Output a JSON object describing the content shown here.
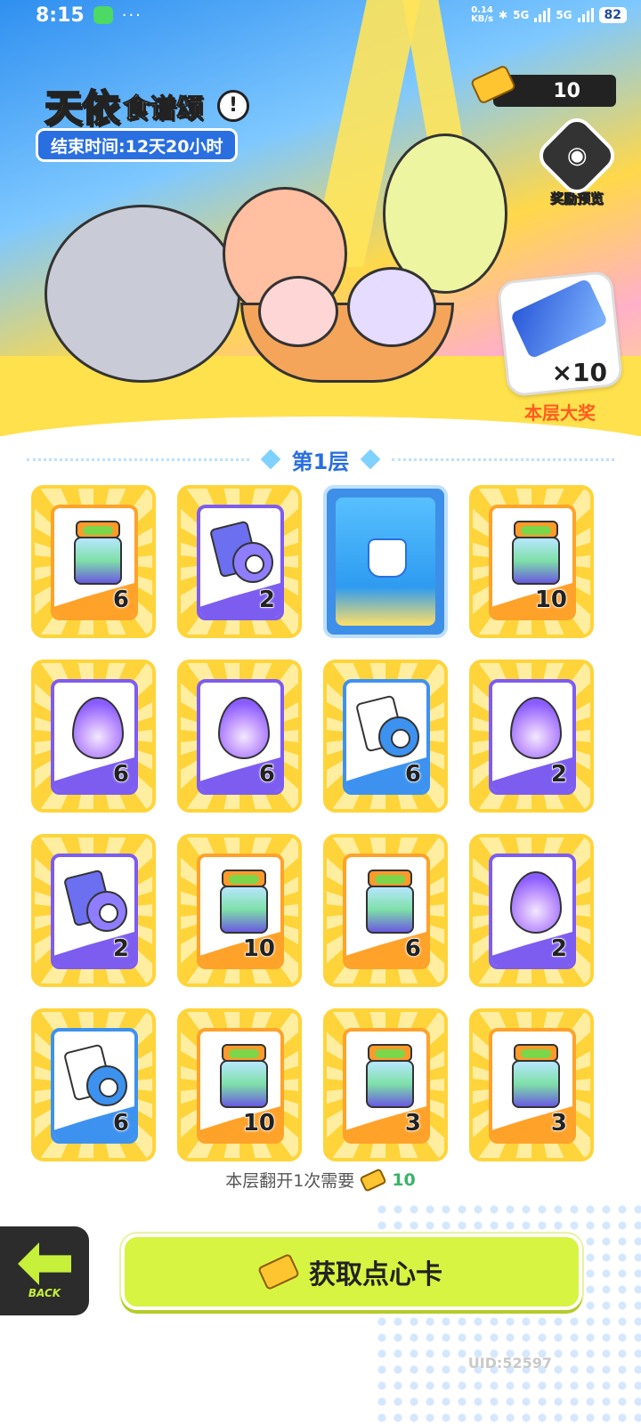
{
  "status_bar": {
    "time": "8:15",
    "net_speed_top": "0.14",
    "net_speed_bottom": "KB/s",
    "sim1": "5G",
    "sim2": "5G",
    "battery": "82",
    "dots": "···"
  },
  "header": {
    "title_main": "天依",
    "title_sub": "食谱颂",
    "info_symbol": "!",
    "end_time": "结束时间:12天20小时",
    "ticket_count": "10",
    "reward_preview_label": "奖励预览"
  },
  "grand_prize": {
    "quantity": "×10",
    "label": "本层大奖"
  },
  "layer": {
    "title": "第1层"
  },
  "cards": [
    {
      "type": "jar",
      "color": "orange",
      "count": "6"
    },
    {
      "type": "tape",
      "color": "purple",
      "count": "2"
    },
    {
      "type": "facedown",
      "color": "blue",
      "count": ""
    },
    {
      "type": "jar",
      "color": "orange",
      "count": "10"
    },
    {
      "type": "flame",
      "color": "purple",
      "count": "6"
    },
    {
      "type": "flame",
      "color": "purple",
      "count": "6"
    },
    {
      "type": "tape",
      "color": "blue",
      "count": "6"
    },
    {
      "type": "flame",
      "color": "purple",
      "count": "2"
    },
    {
      "type": "tape",
      "color": "purple",
      "count": "2"
    },
    {
      "type": "jar",
      "color": "orange",
      "count": "10"
    },
    {
      "type": "jar",
      "color": "orange",
      "count": "6"
    },
    {
      "type": "flame",
      "color": "purple",
      "count": "2"
    },
    {
      "type": "tape",
      "color": "blue",
      "count": "6"
    },
    {
      "type": "jar",
      "color": "orange",
      "count": "10"
    },
    {
      "type": "jar",
      "color": "orange",
      "count": "3"
    },
    {
      "type": "jar",
      "color": "orange",
      "count": "3"
    }
  ],
  "footer": {
    "flip_cost_text": "本层翻开1次需要",
    "flip_cost_value": "10",
    "back_label": "BACK",
    "get_button_label": "获取点心卡",
    "uid": "UID:52597"
  },
  "icons": {
    "ticket": "ticket-icon",
    "info": "info-icon",
    "reward": "reward-preview-icon",
    "back": "back-arrow-icon"
  },
  "colors": {
    "accent_yellow": "#ffd43a",
    "button_green": "#d8f442",
    "title_blue": "#2a6fe0",
    "prize_orange": "#ff5b1f"
  }
}
